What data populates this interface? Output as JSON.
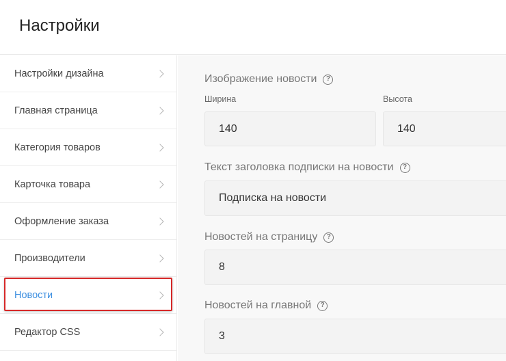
{
  "header": {
    "title": "Настройки"
  },
  "sidebar": {
    "items": [
      {
        "label": "Настройки дизайна"
      },
      {
        "label": "Главная страница"
      },
      {
        "label": "Категория товаров"
      },
      {
        "label": "Карточка товара"
      },
      {
        "label": "Оформление заказа"
      },
      {
        "label": "Производители"
      },
      {
        "label": "Новости"
      },
      {
        "label": "Редактор CSS"
      }
    ],
    "active_index": 6
  },
  "news_image": {
    "title": "Изображение новости",
    "width_label": "Ширина",
    "width_value": "140",
    "height_label": "Высота",
    "height_value": "140"
  },
  "subscription": {
    "title": "Текст заголовка подписки на новости",
    "value": "Подписка на новости"
  },
  "per_page": {
    "title": "Новостей на страницу",
    "value": "8"
  },
  "on_main": {
    "title": "Новостей на главной",
    "value": "3"
  },
  "help_glyph": "?",
  "colors": {
    "active": "#3d8fe0",
    "highlight": "#d62828"
  }
}
